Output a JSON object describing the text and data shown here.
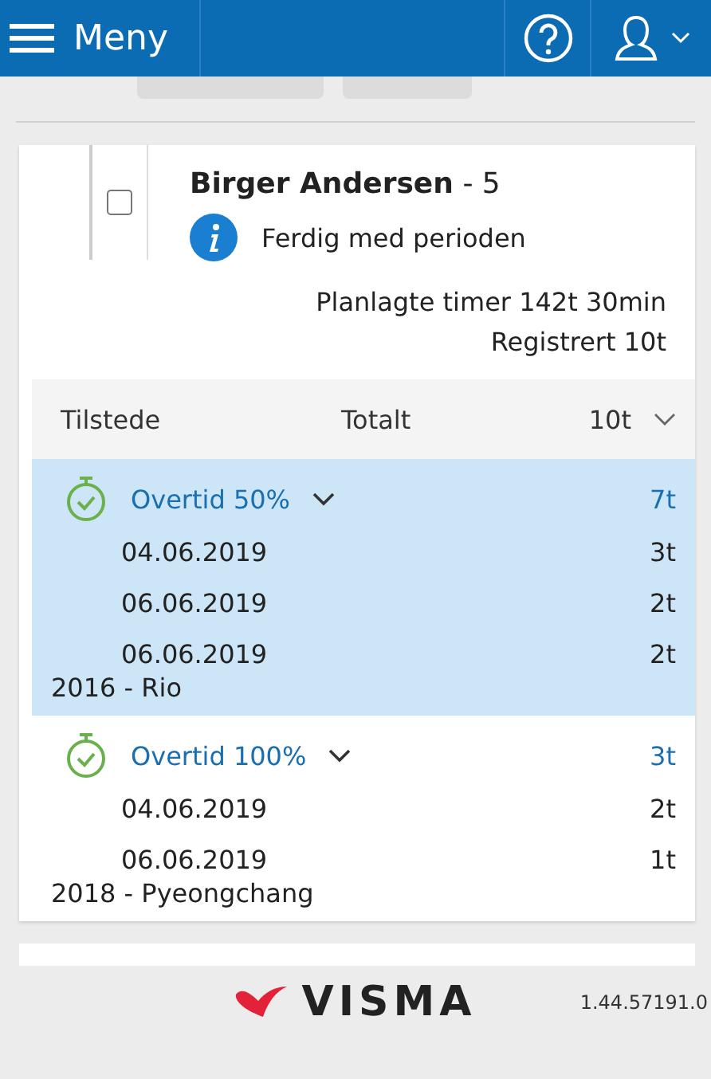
{
  "header": {
    "menu_label": "Meny"
  },
  "employee": {
    "checked": false,
    "name": "Birger Andersen",
    "number": "- 5",
    "status": "Ferdig med perioden",
    "planned": "Planlagte timer 142t 30min",
    "registered": "Registrert 10t"
  },
  "summary": {
    "label": "Tilstede",
    "total_label": "Totalt",
    "total": "10t",
    "expanded": false
  },
  "groups": [
    {
      "title": "Overtid 50%",
      "total": "7t",
      "selected": true,
      "entries": [
        {
          "date": "04.06.2019",
          "hours": "3t"
        },
        {
          "date": "06.06.2019",
          "hours": "2t"
        },
        {
          "date": "06.06.2019",
          "hours": "2t"
        }
      ],
      "project": "2016 - Rio"
    },
    {
      "title": "Overtid 100%",
      "total": "3t",
      "selected": false,
      "entries": [
        {
          "date": "04.06.2019",
          "hours": "2t"
        },
        {
          "date": "06.06.2019",
          "hours": "1t"
        }
      ],
      "project": "2018 - Pyeongchang"
    }
  ],
  "footer": {
    "logo": "VISMA",
    "version": "1.44.57191.0"
  }
}
